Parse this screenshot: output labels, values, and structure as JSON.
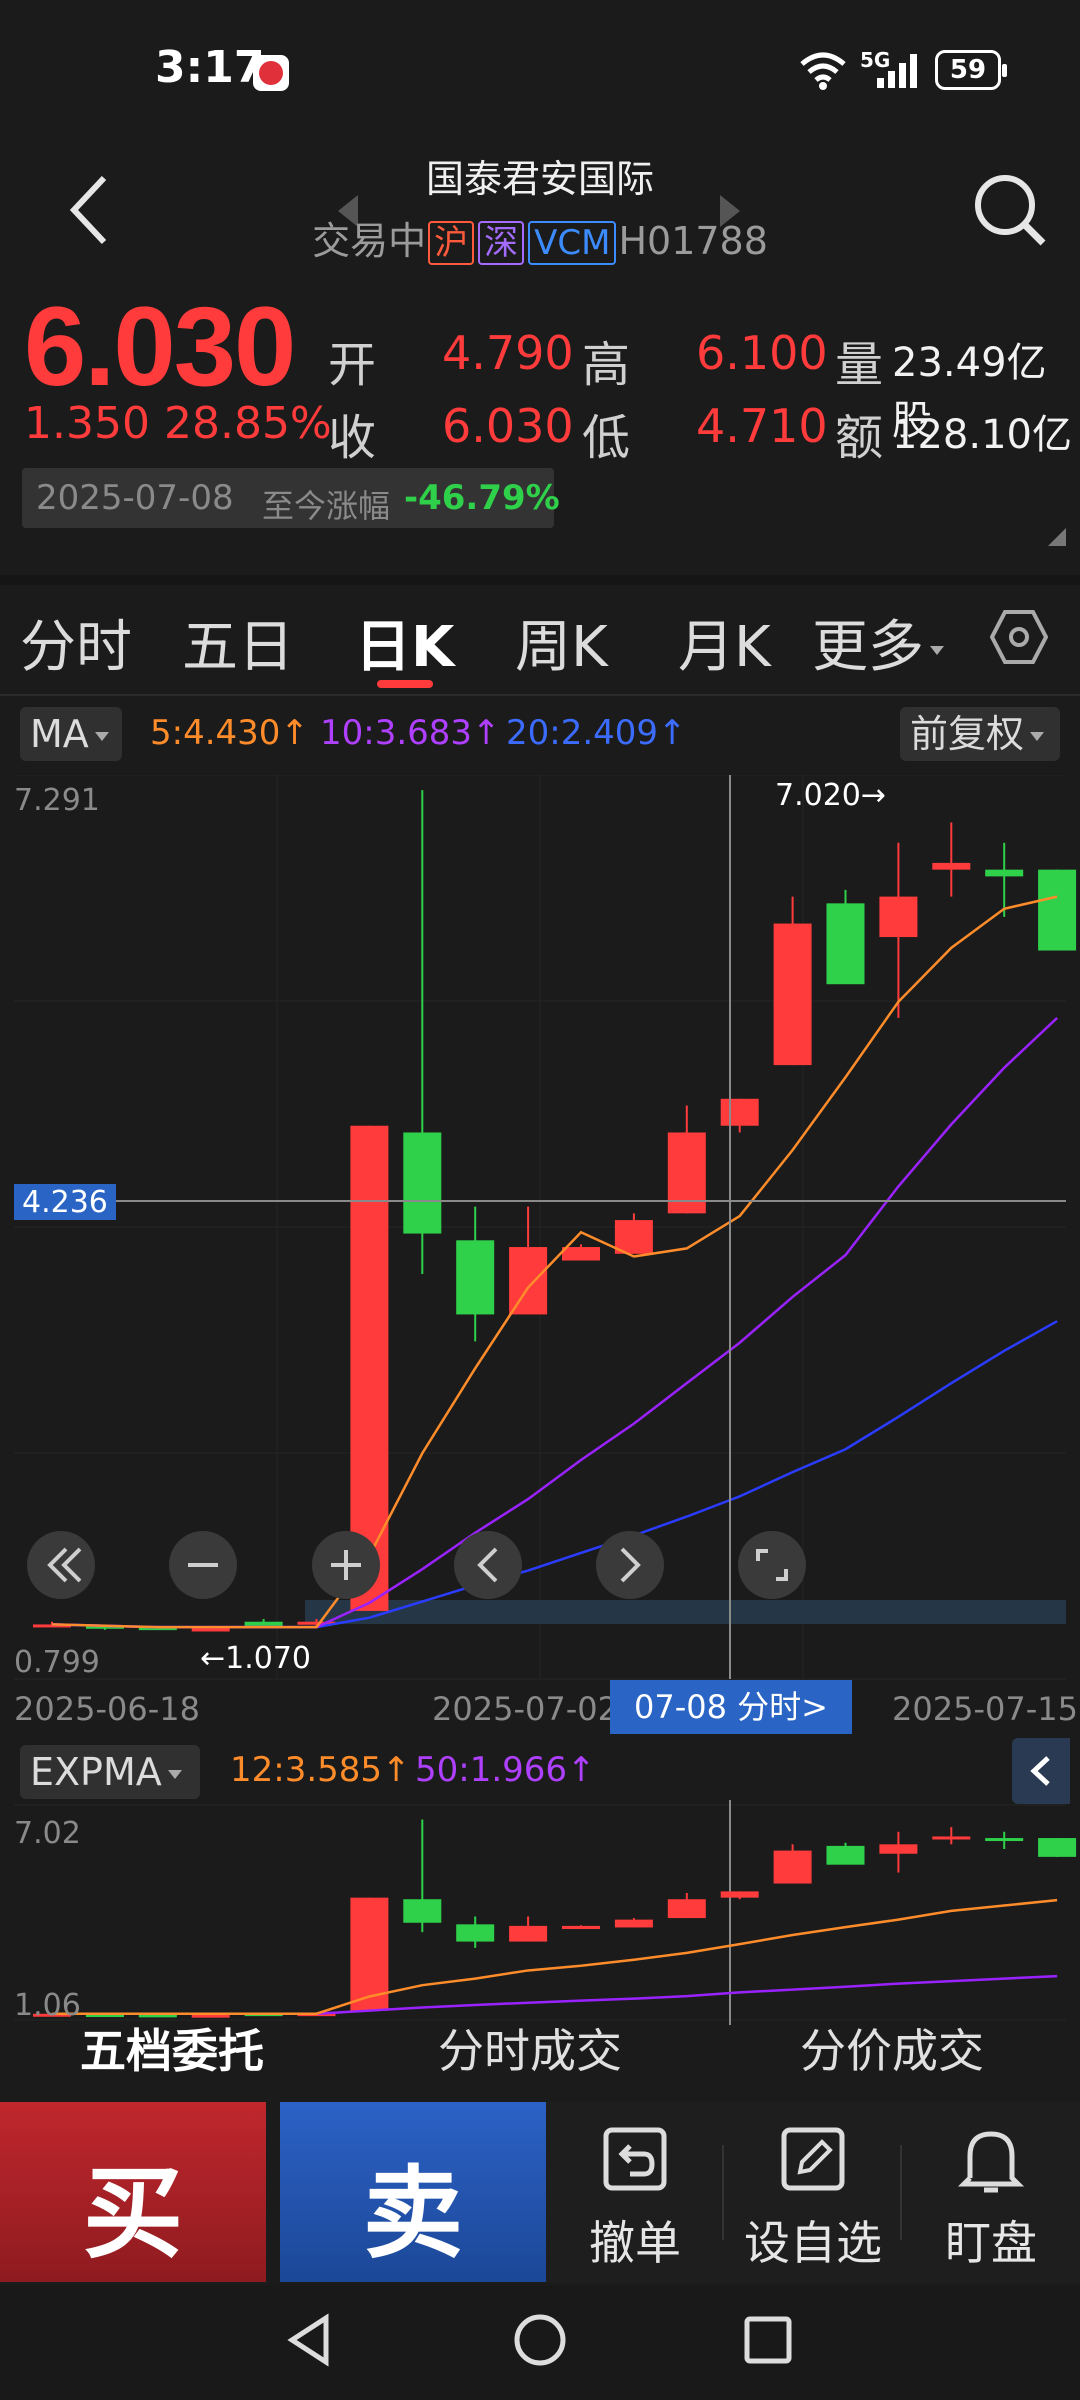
{
  "status_bar": {
    "time": "3:17",
    "network": "5G",
    "battery": "59"
  },
  "header": {
    "name": "国泰君安国际",
    "status": "交易中",
    "tags": [
      "沪",
      "深",
      "VCM"
    ],
    "code": "H01788"
  },
  "quote": {
    "price": "6.030",
    "change": "1.350",
    "change_pct": "28.85%",
    "open_label": "开",
    "open": "4.790",
    "close_label": "收",
    "close": "6.030",
    "high_label": "高",
    "high": "6.100",
    "low_label": "低",
    "low": "4.710",
    "volume_label": "量",
    "volume": "23.49亿股",
    "amount_label": "额",
    "amount": "128.10亿",
    "since_date": "2025-07-08",
    "since_label": "至今涨幅",
    "since_pct": "-46.79%"
  },
  "tabs": [
    "分时",
    "五日",
    "日K",
    "周K",
    "月K",
    "更多"
  ],
  "active_tab": "日K",
  "ma_bar": {
    "indicator": "MA",
    "ma5": "5:4.430↑",
    "ma10": "10:3.683↑",
    "ma20": "20:2.409↑",
    "adjust": "前复权"
  },
  "kline": {
    "y_top": "7.291",
    "y_bottom": "0.799",
    "crosshair_price": "4.236",
    "max_label": "7.020→",
    "min_label": "←1.070",
    "dates": [
      "2025-06-18",
      "2025-07-02",
      "2025-07-15"
    ],
    "fenshi_button": "07-08 分时>"
  },
  "expma_bar": {
    "indicator": "EXPMA",
    "ema12": "12:3.585↑",
    "ema50": "50:1.966↑",
    "y_top": "7.02",
    "y_bottom": "1.06"
  },
  "bottom_tabs": [
    "五档委托",
    "分时成交",
    "分价成交"
  ],
  "actions": {
    "buy": "买",
    "sell": "卖",
    "cancel": "撤单",
    "watch": "设自选",
    "monitor": "盯盘"
  },
  "colors": {
    "up": "#ff3b3b",
    "down": "#2fd04a",
    "ma5": "#ff8c2a",
    "ma10": "#9a22ff",
    "ma20": "#2a3cff",
    "accent": "#2a64c5"
  },
  "chart_data": {
    "type": "candlestick",
    "ylim": [
      0.799,
      7.291
    ],
    "candles": [
      {
        "o": 1.1,
        "h": 1.12,
        "l": 1.08,
        "c": 1.1
      },
      {
        "o": 1.09,
        "h": 1.1,
        "l": 1.06,
        "c": 1.08
      },
      {
        "o": 1.08,
        "h": 1.09,
        "l": 1.06,
        "c": 1.07
      },
      {
        "o": 1.07,
        "h": 1.09,
        "l": 1.07,
        "c": 1.07
      },
      {
        "o": 1.12,
        "h": 1.14,
        "l": 1.07,
        "c": 1.07
      },
      {
        "o": 1.1,
        "h": 1.14,
        "l": 1.09,
        "c": 1.12
      },
      {
        "o": 1.2,
        "h": 4.8,
        "l": 1.2,
        "c": 4.8
      },
      {
        "o": 4.75,
        "h": 7.29,
        "l": 3.7,
        "c": 4.0
      },
      {
        "o": 3.95,
        "h": 4.2,
        "l": 3.2,
        "c": 3.4
      },
      {
        "o": 3.4,
        "h": 4.2,
        "l": 3.4,
        "c": 3.9
      },
      {
        "o": 3.8,
        "h": 3.92,
        "l": 3.8,
        "c": 3.9
      },
      {
        "o": 3.85,
        "h": 4.15,
        "l": 3.85,
        "c": 4.1
      },
      {
        "o": 4.15,
        "h": 4.95,
        "l": 4.15,
        "c": 4.75
      },
      {
        "o": 4.8,
        "h": 5.0,
        "l": 4.75,
        "c": 5.0
      },
      {
        "o": 5.25,
        "h": 6.5,
        "l": 5.25,
        "c": 6.3
      },
      {
        "o": 6.45,
        "h": 6.55,
        "l": 5.95,
        "c": 5.85
      },
      {
        "o": 6.2,
        "h": 6.9,
        "l": 5.6,
        "c": 6.5
      },
      {
        "o": 6.7,
        "h": 7.05,
        "l": 6.5,
        "c": 6.75
      },
      {
        "o": 6.7,
        "h": 6.9,
        "l": 6.35,
        "c": 6.65
      },
      {
        "o": 6.7,
        "h": 6.7,
        "l": 6.1,
        "c": 6.1
      }
    ],
    "ma5": [
      1.1,
      1.09,
      1.08,
      1.08,
      1.08,
      1.08,
      1.61,
      2.37,
      3.0,
      3.6,
      4.01,
      3.83,
      3.89,
      4.13,
      4.62,
      5.16,
      5.72,
      6.12,
      6.41,
      6.5
    ],
    "ma10": [
      1.1,
      1.09,
      1.08,
      1.08,
      1.08,
      1.08,
      1.26,
      1.51,
      1.78,
      2.03,
      2.32,
      2.59,
      2.89,
      3.19,
      3.53,
      3.84,
      4.35,
      4.81,
      5.23,
      5.6
    ],
    "ma20": [
      1.1,
      1.09,
      1.08,
      1.08,
      1.08,
      1.08,
      1.15,
      1.27,
      1.39,
      1.5,
      1.63,
      1.76,
      1.9,
      2.05,
      2.23,
      2.4,
      2.64,
      2.89,
      3.13,
      3.35
    ],
    "ema_ylim": [
      1.06,
      7.02
    ],
    "ema12": [
      1.1,
      1.1,
      1.1,
      1.1,
      1.1,
      1.1,
      1.65,
      2.01,
      2.22,
      2.48,
      2.63,
      2.82,
      3.04,
      3.32,
      3.61,
      3.86,
      4.1,
      4.38,
      4.55,
      4.72
    ],
    "ema50": [
      1.1,
      1.1,
      1.1,
      1.1,
      1.1,
      1.1,
      1.2,
      1.3,
      1.38,
      1.45,
      1.52,
      1.58,
      1.66,
      1.78,
      1.87,
      1.96,
      2.06,
      2.14,
      2.22,
      2.3
    ]
  }
}
